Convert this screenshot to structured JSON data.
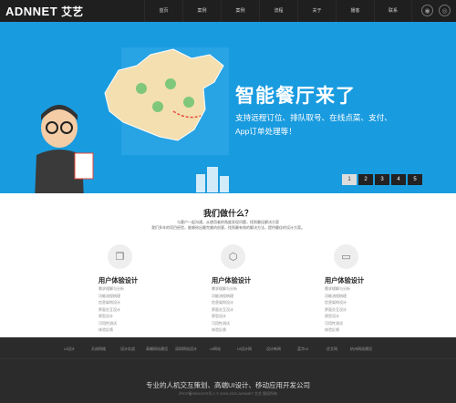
{
  "header": {
    "logo_text": "ADNNET",
    "logo_cn": "艾艺",
    "nav": [
      "首页",
      "案例",
      "案例",
      "流程",
      "关于",
      "播客",
      "联系"
    ]
  },
  "banner": {
    "title": "智能餐厅来了",
    "subtitle": "支持远程订位、排队取号、在线点菜、支付、App订单处理等！",
    "pages": [
      "1",
      "2",
      "3",
      "4",
      "5"
    ],
    "active_page": 1
  },
  "services": {
    "title": "我们做什么？",
    "desc": [
      "与客户一起沟通，从使用者的角度发现问题，找到最佳解决方案",
      "我们多年的项目经验，能够给出最完美的创意，找到最有效的解决方法，提供最佳的设计方案。"
    ],
    "columns": [
      {
        "title": "用户体验设计",
        "items": [
          "需求理解与分析",
          "功能流程梳理",
          "信息架构设计",
          "界面交互设计",
          "原型设计",
          "可用性测试",
          "体验反馈"
        ]
      },
      {
        "title": "用户体验设计",
        "items": [
          "需求理解与分析",
          "功能流程梳理",
          "信息架构设计",
          "界面交互设计",
          "原型设计",
          "可用性测试",
          "体验反馈"
        ]
      },
      {
        "title": "用户体验设计",
        "items": [
          "需求理解与分析",
          "功能流程梳理",
          "信息架构设计",
          "界面交互设计",
          "原型设计",
          "可用性测试",
          "体验反馈"
        ]
      }
    ]
  },
  "footer": {
    "links": [
      "UI设计",
      "天成网络",
      "设计实战",
      "高端网站建设",
      "深圳网站设计",
      "UI网站",
      "UI设计网",
      "设计新闻",
      "蓝字UI",
      "优艾网",
      "杭州网站建设"
    ],
    "main": "专业的人机交互策划、高端UI设计、移动应用开发公司",
    "copy": "沪ICP备09042975号-1 © 2009-2022 ADNNET 艾艺 版权所有"
  },
  "colors": {
    "header_bg": "#1f1f1f",
    "banner_bg": "#199bdf",
    "footer_bg": "#2b2b2b"
  }
}
